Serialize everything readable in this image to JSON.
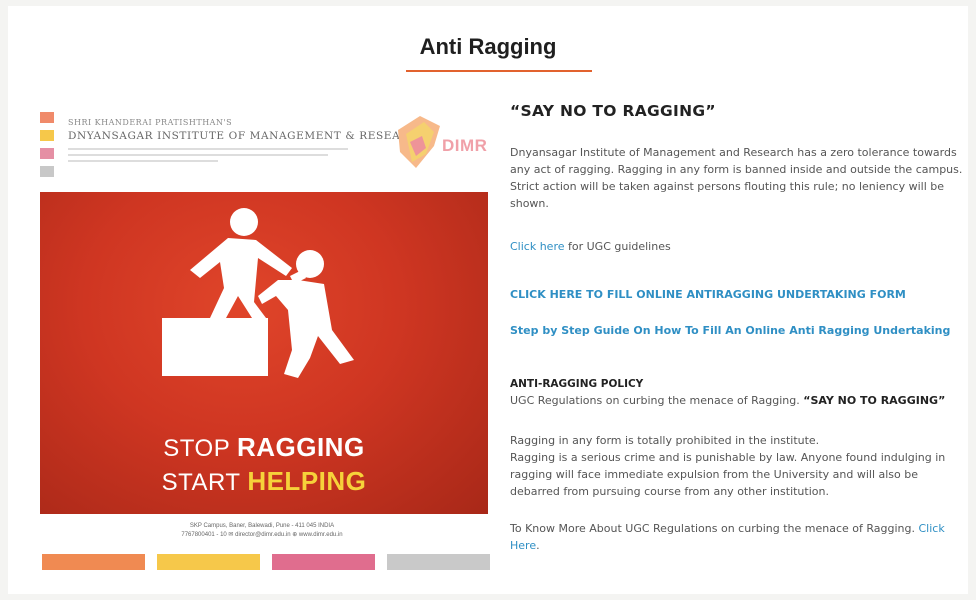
{
  "header": {
    "title": "Anti Ragging"
  },
  "colors": {
    "accent": "#e2622e",
    "link": "#2f8fc4",
    "poster_red": "#d23b24",
    "poster_yellow": "#f6d23a"
  },
  "poster": {
    "institute_line1": "SHRI KHANDERAI PRATISHTHAN'S",
    "institute_line2": "DNYANSAGAR INSTITUTE OF MANAGEMENT & RESEARCH",
    "logo_text": "DIMR",
    "stop_word": "STOP",
    "ragging_word": "RAGGING",
    "start_word": "START",
    "helping_word": "HELPING",
    "address_line1": "SKP Campus, Baner, Balewadi, Pune - 411 045 INDIA",
    "address_line2": "7767800401 - 10 ✉ director@dimr.edu.in ⊕ www.dimr.edu.in",
    "square_colors": [
      "#f08a6a",
      "#f6c84a",
      "#e58fa4",
      "#c8c8c8"
    ],
    "bar_colors": [
      "#f08a52",
      "#f6c84a",
      "#e06d8e",
      "#c9c9c9"
    ],
    "icon": "helping-hand-pictogram-icon"
  },
  "content": {
    "title": "“SAY NO TO RAGGING”",
    "intro": "Dnyansagar Institute of Management and Research has a zero tolerance towards any act of ragging. Ragging in any form is banned inside and outside the campus. Strict action will be taken against persons flouting this rule; no leniency will be shown.",
    "ugc_link": "Click here",
    "ugc_suffix": " for UGC guidelines",
    "form_link": "CLICK HERE TO FILL ONLINE ANTIRAGGING UNDERTAKING FORM",
    "guide_link": "Step by Step Guide On How To Fill An Online Anti Ragging Undertaking",
    "policy_title": "ANTI-RAGGING POLICY",
    "policy_prefix": "UGC Regulations on curbing the menace of Ragging. ",
    "policy_bold": "“SAY NO TO RAGGING”",
    "prohibited_line1": "Ragging in any form is totally prohibited in the institute.",
    "prohibited_line2": "Ragging is a serious crime and is punishable by law. Anyone found indulging in ragging will face immediate expulsion from the University and will also be debarred from pursuing course from any other institution.",
    "more_prefix": "To Know More About UGC Regulations on curbing the menace of Ragging. ",
    "more_link": "Click Here",
    "more_suffix": "."
  }
}
